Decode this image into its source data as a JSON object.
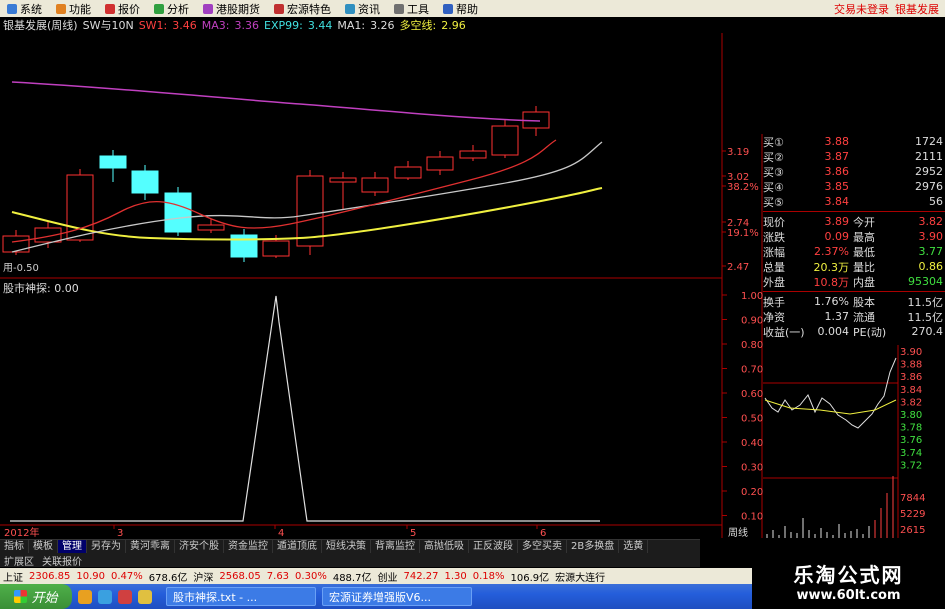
{
  "menu": {
    "items": [
      "系统",
      "功能",
      "报价",
      "分析",
      "港股期货",
      "宏源特色",
      "资讯",
      "工具",
      "帮助"
    ],
    "right": [
      "交易未登录",
      "银基发展"
    ]
  },
  "info": {
    "title": "银基发展(周线)",
    "sw": "SW与10N",
    "sw1_label": "SW1:",
    "sw1": "3.46",
    "ma3_label": "MA3:",
    "ma3": "3.36",
    "exp_label": "EXP99:",
    "exp": "3.44",
    "ma1_label": "MA1:",
    "ma1": "3.26",
    "dk_label": "多空线:",
    "dk": "2.96"
  },
  "price_axis": [
    "3.19",
    "3.02",
    "38.2%",
    "2.74",
    "19.1%",
    "2.47"
  ],
  "chart_note": "用-0.50",
  "indicator": {
    "name": "股市神探",
    "value": ": 0.00",
    "axis": [
      "1.00",
      "0.90",
      "0.80",
      "0.70",
      "0.60",
      "0.50",
      "0.40",
      "0.30",
      "0.20",
      "0.10"
    ]
  },
  "time_axis": {
    "year": "2012年",
    "ticks": [
      "3",
      "4",
      "5",
      "6"
    ],
    "period": "周线"
  },
  "quote": {
    "buys": [
      {
        "label": "买①",
        "price": "3.88",
        "vol": "1724"
      },
      {
        "label": "买②",
        "price": "3.87",
        "vol": "2111"
      },
      {
        "label": "买③",
        "price": "3.86",
        "vol": "2952"
      },
      {
        "label": "买④",
        "price": "3.85",
        "vol": "2976"
      },
      {
        "label": "买⑤",
        "price": "3.84",
        "vol": "56"
      }
    ],
    "stats1": [
      {
        "l": "现价",
        "v": "3.89",
        "l2": "今开",
        "v2": "3.82"
      },
      {
        "l": "涨跌",
        "v": "0.09",
        "l2": "最高",
        "v2": "3.90"
      },
      {
        "l": "涨幅",
        "v": "2.37%",
        "l2": "最低",
        "v2": "3.77"
      },
      {
        "l": "总量",
        "v": "20.3万",
        "l2": "量比",
        "v2": "0.86"
      },
      {
        "l": "外盘",
        "v": "10.8万",
        "l2": "内盘",
        "v2": "95304"
      }
    ],
    "stats2": [
      {
        "l": "换手",
        "v": "1.76%",
        "l2": "股本",
        "v2": "11.5亿"
      },
      {
        "l": "净资",
        "v": "1.37",
        "l2": "流通",
        "v2": "11.5亿"
      },
      {
        "l": "收益(一)",
        "v": "0.004",
        "l2": "PE(动)",
        "v2": "270.4"
      }
    ]
  },
  "mini_axis": [
    "3.90",
    "3.88",
    "3.86",
    "3.84",
    "3.82",
    "3.80",
    "3.78",
    "3.76",
    "3.74",
    "3.72"
  ],
  "mini_vol_axis": [
    "7844",
    "5229",
    "2615"
  ],
  "tabs": [
    "指标",
    "模板",
    "管理",
    "另存为",
    "黄河乖离",
    "济安个股",
    "资金监控",
    "遁道顶底",
    "短线决策",
    "背离监控",
    "高抛低吸",
    "正反波段",
    "多空买卖",
    "2B多换盘",
    "选黄"
  ],
  "ext_tabs": [
    "扩展区",
    "关联报价"
  ],
  "status": [
    {
      "t": "上证",
      "c": "#000"
    },
    {
      "t": "2306.85",
      "c": "#d00"
    },
    {
      "t": "10.90",
      "c": "#d00"
    },
    {
      "t": "0.47%",
      "c": "#d00"
    },
    {
      "t": "678.6亿",
      "c": "#000"
    },
    {
      "t": "沪深",
      "c": "#000"
    },
    {
      "t": "2568.05",
      "c": "#d00"
    },
    {
      "t": "7.63",
      "c": "#d00"
    },
    {
      "t": "0.30%",
      "c": "#d00"
    },
    {
      "t": "488.7亿",
      "c": "#000"
    },
    {
      "t": "创业",
      "c": "#000"
    },
    {
      "t": "742.27",
      "c": "#d00"
    },
    {
      "t": "1.30",
      "c": "#d00"
    },
    {
      "t": "0.18%",
      "c": "#d00"
    },
    {
      "t": "106.9亿",
      "c": "#000"
    },
    {
      "t": "宏源大连行",
      "c": "#000"
    }
  ],
  "taskbar": {
    "start": "开始",
    "tasks": [
      "股市神探.txt - ...",
      "宏源证券增强版V6..."
    ]
  },
  "watermark": {
    "big": "乐淘公式网",
    "small": "www.60lt.com"
  },
  "colors": {
    "up": "#ff3232",
    "down": "#54ffff",
    "ma_purple": "#c040c0",
    "ma_yellow": "#f0f040",
    "ma_white": "#c8c8c8",
    "ma_red": "#e03030"
  }
}
